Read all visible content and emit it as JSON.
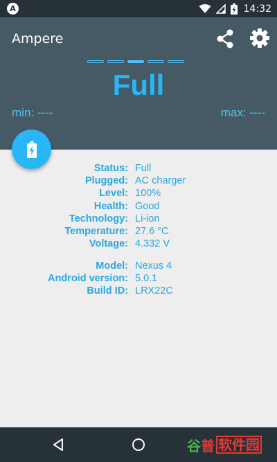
{
  "status_bar": {
    "left_icon_letter": "A",
    "time": "14:32"
  },
  "header": {
    "app_title": "Ampere",
    "pages": {
      "count": 5,
      "active": 3
    },
    "charge_status": "Full",
    "min_label": "min: ----",
    "max_label": "max: ----"
  },
  "battery_info": [
    {
      "label": "Status:",
      "value": "Full"
    },
    {
      "label": "Plugged:",
      "value": "AC charger"
    },
    {
      "label": "Level:",
      "value": "100%"
    },
    {
      "label": "Health:",
      "value": "Good"
    },
    {
      "label": "Technology:",
      "value": "Li-ion"
    },
    {
      "label": "Temperature:",
      "value": "27.6 °C"
    },
    {
      "label": "Voltage:",
      "value": "4.332 V"
    }
  ],
  "device_info": [
    {
      "label": "Model:",
      "value": "Nexus 4"
    },
    {
      "label": "Android version:",
      "value": "5.0.1"
    },
    {
      "label": "Build ID:",
      "value": "LRX22C"
    }
  ],
  "watermark": {
    "part1": "谷",
    "part2": "普",
    "part3": "软件园"
  },
  "colors": {
    "accent": "#29b6f6",
    "header_bg": "#455a64",
    "status_bar_bg": "#263238",
    "content_bg": "#eeeeee"
  },
  "icons": {
    "fab": "battery-charging-icon",
    "share": "share-icon",
    "settings": "gear-icon",
    "nav_back": "back-triangle-icon",
    "nav_home": "home-circle-icon"
  }
}
